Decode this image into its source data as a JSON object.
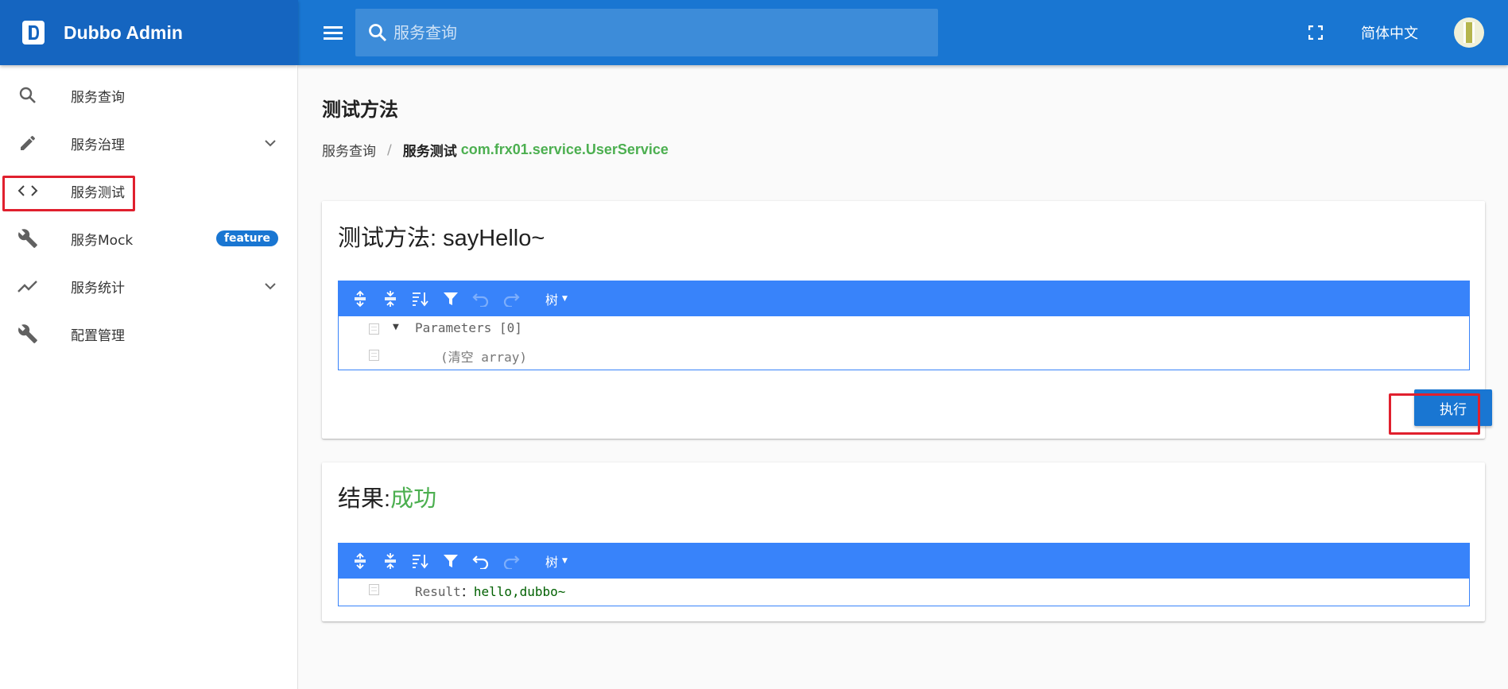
{
  "brand": {
    "title": "Dubbo Admin"
  },
  "header": {
    "search_placeholder": "服务查询",
    "language": "简体中文"
  },
  "sidebar": {
    "items": [
      {
        "label": "服务查询",
        "icon": "search-icon"
      },
      {
        "label": "服务治理",
        "icon": "pencil-icon",
        "has_children": true
      },
      {
        "label": "服务测试",
        "icon": "code-icon",
        "highlighted": true
      },
      {
        "label": "服务Mock",
        "icon": "wrench-icon",
        "badge": "feature"
      },
      {
        "label": "服务统计",
        "icon": "trend-icon",
        "has_children": true
      },
      {
        "label": "配置管理",
        "icon": "wrench-icon"
      }
    ]
  },
  "main": {
    "title": "测试方法",
    "breadcrumb": {
      "link": "服务查询",
      "separator": "/",
      "current": "服务测试",
      "service": "com.frx01.service.UserService"
    },
    "method_card": {
      "title": "测试方法: sayHello~",
      "editor": {
        "mode": "树",
        "rows": [
          {
            "text": "Parameters [0]",
            "expanded": true
          },
          {
            "text": "(清空 array)"
          }
        ]
      },
      "execute_label": "执行"
    },
    "result_card": {
      "title_prefix": "结果:",
      "status": "成功",
      "editor": {
        "mode": "树",
        "key": "Result",
        "colon": "：",
        "value": "hello,dubbo~"
      }
    }
  },
  "colors": {
    "primary": "#1976d2",
    "brand": "#1565c0",
    "editor_blue": "#3883fa",
    "success": "#4caf50",
    "highlight": "#e0202e"
  }
}
